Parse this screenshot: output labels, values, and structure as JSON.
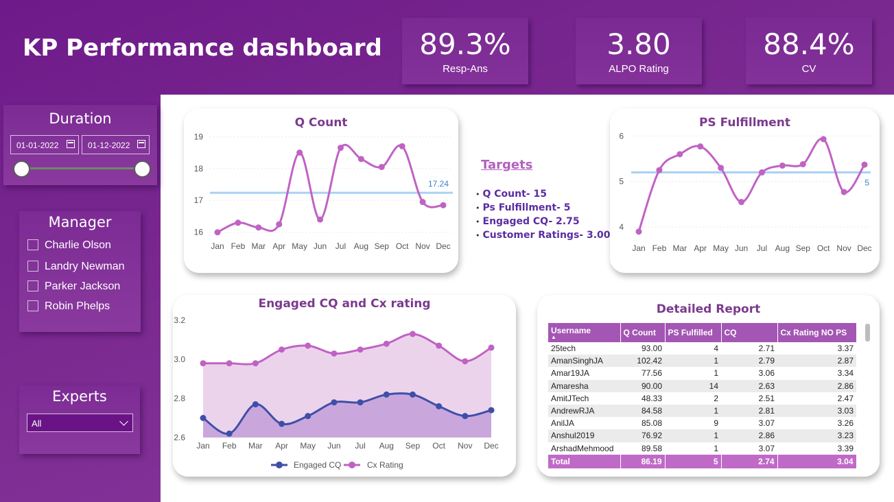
{
  "header": {
    "title": "KP Performance dashboard"
  },
  "kpis": [
    {
      "value": "89.3%",
      "label": "Resp-Ans"
    },
    {
      "value": "3.80",
      "label": "ALPO Rating"
    },
    {
      "value": "88.4%",
      "label": "CV"
    }
  ],
  "duration": {
    "title": "Duration",
    "start": "01-01-2022",
    "end": "01-12-2022"
  },
  "manager": {
    "title": "Manager",
    "items": [
      "Charlie Olson",
      "Landry Newman",
      "Parker Jackson",
      "Robin Phelps"
    ]
  },
  "experts": {
    "title": "Experts",
    "selected": "All"
  },
  "targets": {
    "title": "Targets",
    "items": [
      "Q Count- 15",
      "Ps Fulfillment- 5",
      "Engaged CQ- 2.75",
      "Customer Ratings- 3.00"
    ]
  },
  "colors": {
    "line": "#c062c4",
    "target_line": "#a9d0f5",
    "engaged": "#3e4fa8",
    "area_cx": "#ecd3ec",
    "area_engaged": "#c9a7dc",
    "title": "#7b3a8e"
  },
  "chart_data": [
    {
      "type": "line",
      "title": "Q Count",
      "categories": [
        "Jan",
        "Feb",
        "Mar",
        "Apr",
        "May",
        "Jun",
        "Jul",
        "Aug",
        "Sep",
        "Oct",
        "Nov",
        "Dec"
      ],
      "series": [
        {
          "values": [
            16.0,
            16.3,
            16.15,
            16.25,
            18.5,
            16.4,
            18.65,
            18.3,
            18.05,
            18.7,
            16.95,
            16.85
          ]
        }
      ],
      "reference_line": {
        "value": 17.24,
        "label": "17.24"
      },
      "yticks": [
        16,
        17,
        18,
        19
      ],
      "ylim": [
        15.8,
        19.2
      ],
      "grid": "dotted"
    },
    {
      "type": "line",
      "title": "PS Fulfillment",
      "categories": [
        "Jan",
        "Feb",
        "Mar",
        "Apr",
        "May",
        "Jun",
        "Jul",
        "Aug",
        "Sep",
        "Oct",
        "Nov",
        "Dec"
      ],
      "series": [
        {
          "values": [
            3.9,
            5.25,
            5.6,
            5.77,
            5.3,
            4.55,
            5.2,
            5.35,
            5.38,
            5.93,
            4.77,
            5.37
          ]
        }
      ],
      "reference_line": {
        "value": 5.2,
        "label": "5"
      },
      "yticks": [
        4,
        5,
        6
      ],
      "ylim": [
        3.7,
        6.2
      ],
      "grid": "dotted"
    },
    {
      "type": "area",
      "title": "Engaged CQ and Cx rating",
      "categories": [
        "Jan",
        "Feb",
        "Mar",
        "Apr",
        "May",
        "Jun",
        "Jul",
        "Aug",
        "Sep",
        "Oct",
        "Nov",
        "Dec"
      ],
      "series": [
        {
          "name": "Engaged CQ",
          "values": [
            2.7,
            2.62,
            2.77,
            2.67,
            2.71,
            2.78,
            2.78,
            2.82,
            2.82,
            2.76,
            2.71,
            2.74
          ]
        },
        {
          "name": "Cx Rating",
          "values": [
            2.98,
            2.98,
            2.98,
            3.05,
            3.07,
            3.03,
            3.05,
            3.08,
            3.13,
            3.07,
            2.99,
            3.06
          ]
        }
      ],
      "yticks": [
        "2.6",
        "2.8",
        "3.0",
        "3.2"
      ],
      "ylim": [
        2.6,
        3.2
      ],
      "legend": "bottom-center"
    },
    {
      "type": "table",
      "title": "Detailed Report",
      "columns": [
        "Username",
        "Q Count",
        "PS Fulfilled",
        "CQ",
        "Cx Rating NO PS"
      ],
      "rows": [
        [
          "25tech",
          "93.00",
          "4",
          "2.71",
          "3.37"
        ],
        [
          "AmanSinghJA",
          "102.42",
          "1",
          "2.79",
          "2.87"
        ],
        [
          "Amar19JA",
          "77.56",
          "1",
          "3.06",
          "3.34"
        ],
        [
          "Amaresha",
          "90.00",
          "14",
          "2.63",
          "2.86"
        ],
        [
          "AmitJTech",
          "48.33",
          "2",
          "2.51",
          "2.47"
        ],
        [
          "AndrewRJA",
          "84.58",
          "1",
          "2.81",
          "3.03"
        ],
        [
          "AnilJA",
          "85.08",
          "9",
          "3.07",
          "3.26"
        ],
        [
          "Anshul2019",
          "76.92",
          "1",
          "2.86",
          "3.23"
        ],
        [
          "ArshadMehmood",
          "89.58",
          "1",
          "3.07",
          "3.39"
        ]
      ],
      "total": [
        "Total",
        "86.19",
        "5",
        "2.74",
        "3.04"
      ]
    }
  ]
}
